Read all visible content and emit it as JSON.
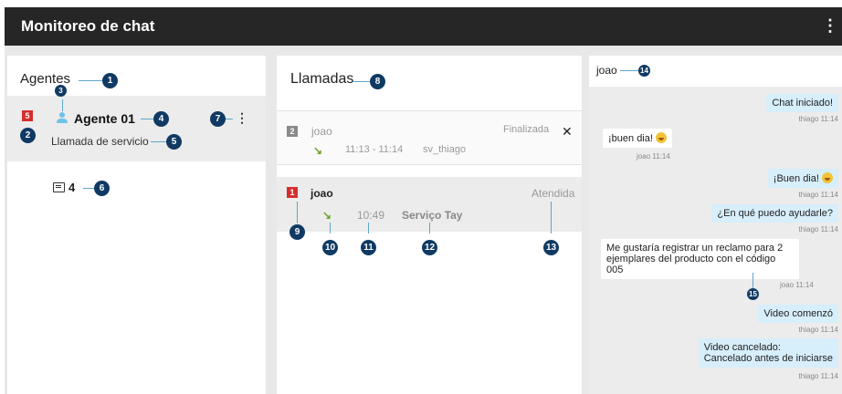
{
  "app": {
    "title": "Monitoreo de chat",
    "menu_icon": "more-vert-icon"
  },
  "agents_panel": {
    "title": "Agentes",
    "agent": {
      "status_count": "5",
      "name": "Agente 01",
      "activity": "Llamada de servicio",
      "chat_count": "4"
    }
  },
  "calls_panel": {
    "title": "Llamadas",
    "calls": [
      {
        "badge": "2",
        "name": "joao",
        "status": "Finalizada",
        "time": "11:13 - 11:14",
        "service": "sv_thiago"
      },
      {
        "badge": "1",
        "name": "joao",
        "status": "Atendida",
        "time": "10:49",
        "service": "Serviço Tay"
      }
    ]
  },
  "chat_panel": {
    "contact": "joao",
    "messages": [
      {
        "side": "right",
        "text": "Chat iniciado!",
        "time": "thiago 11:14"
      },
      {
        "side": "left",
        "text": "¡buen dia!",
        "time": "joao 11:14"
      },
      {
        "side": "right",
        "text": "¡Buen dia!",
        "time": "thiago 11:14"
      },
      {
        "side": "right",
        "text": "¿En qué puedo ayudarle?",
        "time": "thiago 11:14"
      },
      {
        "side": "left",
        "text": "Me gustaría registrar un reclamo para 2",
        "text2": "ejemplares del producto con el código 005",
        "time": "joao 11:14"
      },
      {
        "side": "right",
        "text": "Video comenzó",
        "time": "thiago 11:14"
      },
      {
        "side": "right",
        "text": "Video cancelado:",
        "text2": "Cancelado antes de iniciarse",
        "time": "thiago 11:14"
      }
    ]
  },
  "callouts": [
    "1",
    "2",
    "3",
    "4",
    "5",
    "6",
    "7",
    "8",
    "9",
    "10",
    "11",
    "12",
    "13",
    "14",
    "15"
  ],
  "colors": {
    "accent": "#103a63",
    "callout_line": "#5fa6c8",
    "badge_red": "#d62d2d",
    "chat_bubble": "#d7eefb",
    "topbar": "#262626"
  }
}
